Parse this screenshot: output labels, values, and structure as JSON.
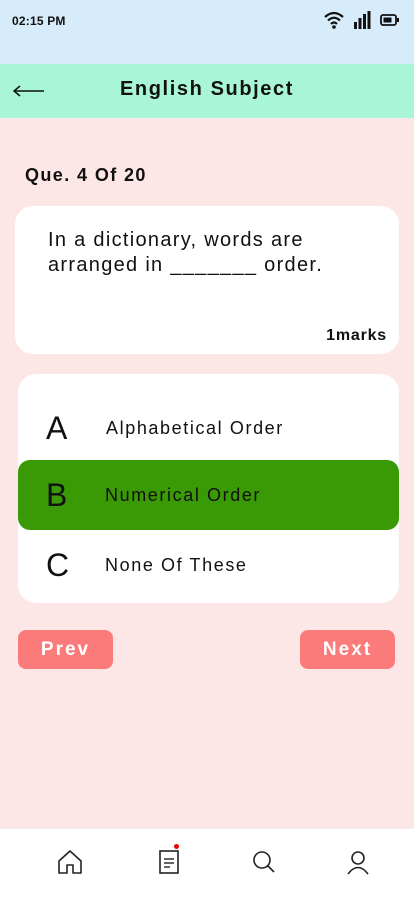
{
  "status_bar": {
    "time": "02:15 PM"
  },
  "header": {
    "title": "English Subject"
  },
  "question": {
    "counter": "Que. 4 Of 20",
    "text": "In a dictionary, words are arranged in _______ order.",
    "marks": "1marks"
  },
  "options": [
    {
      "letter": "A",
      "text": "Alphabetical Order",
      "selected": false
    },
    {
      "letter": "B",
      "text": "Numerical Order",
      "selected": true
    },
    {
      "letter": "C",
      "text": "None Of These",
      "selected": false
    }
  ],
  "buttons": {
    "prev": "Prev",
    "next": "Next"
  },
  "bottom_nav": {
    "items": [
      "home-icon",
      "notes-icon",
      "search-icon",
      "profile-icon"
    ],
    "notes_has_badge": true
  },
  "colors": {
    "status_bar_bg": "#d6ecfb",
    "header_bg": "#a8f5d8",
    "page_bg": "#fde6e6",
    "selected_option": "#3a9a06",
    "button_bg": "#fb7b7b",
    "badge": "#e00000"
  }
}
